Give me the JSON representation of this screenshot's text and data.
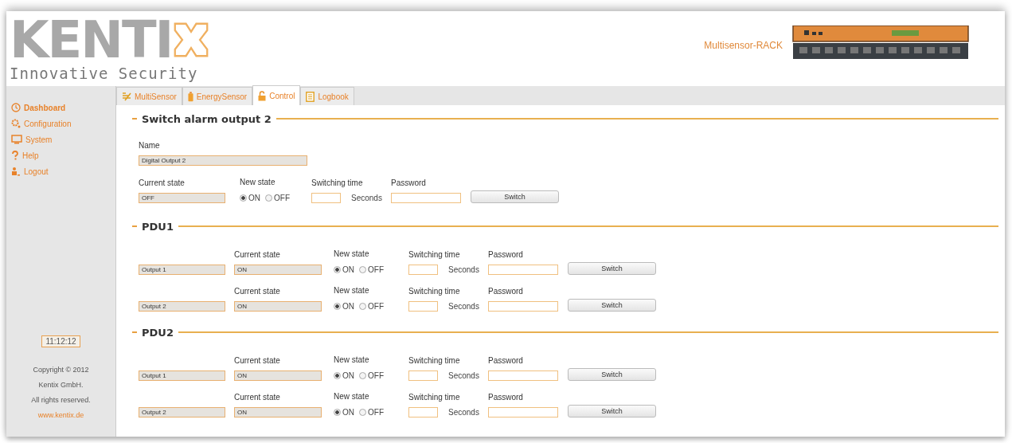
{
  "header": {
    "logo_text": "KENTI",
    "tagline": "Innovative Security",
    "product": "Multisensor-RACK"
  },
  "sidebar": {
    "items": [
      {
        "label": "Dashboard",
        "selected": true
      },
      {
        "label": "Configuration",
        "selected": false
      },
      {
        "label": "System",
        "selected": false
      },
      {
        "label": "Help",
        "selected": false
      },
      {
        "label": "Logout",
        "selected": false
      }
    ],
    "time": "11:12:12",
    "copyright": [
      "Copyright © 2012",
      "Kentix GmbH.",
      "All rights reserved."
    ],
    "link": "www.kentix.de"
  },
  "tabs": [
    {
      "label": "MultiSensor",
      "selected": false
    },
    {
      "label": "EnergySensor",
      "selected": false
    },
    {
      "label": "Control",
      "selected": true
    },
    {
      "label": "Logbook",
      "selected": false
    }
  ],
  "alarm_section": {
    "title": "Switch alarm output 2",
    "name_label": "Name",
    "name_value": "Digital Output 2",
    "row": {
      "current_label": "Current state",
      "current_state": "OFF",
      "new_state_label": "New state",
      "options": [
        {
          "label": "ON",
          "selected": true
        },
        {
          "label": "OFF",
          "selected": false
        }
      ],
      "time_label": "Switching time",
      "seconds_label": "Seconds",
      "password_label": "Password",
      "button": "Switch"
    }
  },
  "pdu_sections": [
    {
      "title": "PDU1",
      "rows": [
        {
          "name": "Output 1",
          "current_label": "Current state",
          "current_state": "ON",
          "new_state_label": "New state",
          "options": [
            {
              "label": "ON",
              "selected": true
            },
            {
              "label": "OFF",
              "selected": false
            }
          ],
          "time_label": "Switching time",
          "seconds_label": "Seconds",
          "password_label": "Password",
          "button": "Switch"
        },
        {
          "name": "Output 2",
          "current_label": "Current state",
          "current_state": "ON",
          "new_state_label": "New state",
          "options": [
            {
              "label": "ON",
              "selected": true
            },
            {
              "label": "OFF",
              "selected": false
            }
          ],
          "time_label": "Switching time",
          "seconds_label": "Seconds",
          "password_label": "Password",
          "button": "Switch"
        }
      ]
    },
    {
      "title": "PDU2",
      "rows": [
        {
          "name": "Output 1",
          "current_label": "Current state",
          "current_state": "ON",
          "new_state_label": "New state",
          "options": [
            {
              "label": "ON",
              "selected": true
            },
            {
              "label": "OFF",
              "selected": false
            }
          ],
          "time_label": "Switching time",
          "seconds_label": "Seconds",
          "password_label": "Password",
          "button": "Switch"
        },
        {
          "name": "Output 2",
          "current_label": "Current state",
          "current_state": "ON",
          "new_state_label": "New state",
          "options": [
            {
              "label": "ON",
              "selected": true
            },
            {
              "label": "OFF",
              "selected": false
            }
          ],
          "time_label": "Switching time",
          "seconds_label": "Seconds",
          "password_label": "Password",
          "button": "Switch"
        }
      ]
    }
  ]
}
